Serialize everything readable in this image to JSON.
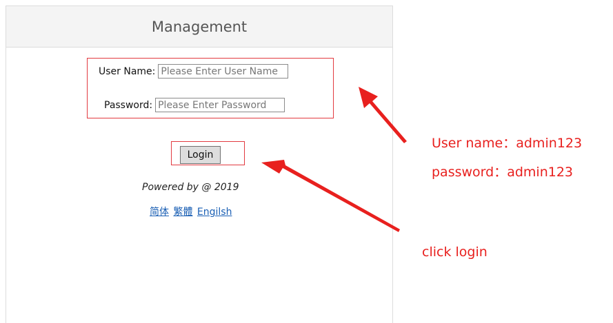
{
  "panel": {
    "title": "Management"
  },
  "form": {
    "username_label": "User Name:",
    "username_placeholder": "Please Enter User Name",
    "username_value": "",
    "password_label": "Password:",
    "password_placeholder": "Please Enter Password",
    "password_value": "",
    "login_label": "Login"
  },
  "footer": {
    "powered": "Powered by @ 2019",
    "languages": [
      "简体",
      "繁體",
      "Engilsh"
    ]
  },
  "annotations": {
    "username_note": "User name：admin123",
    "password_note": "password：admin123",
    "login_note": "click login"
  },
  "colors": {
    "annotation_red": "#e8201e",
    "link_blue": "#1a5fb4"
  }
}
